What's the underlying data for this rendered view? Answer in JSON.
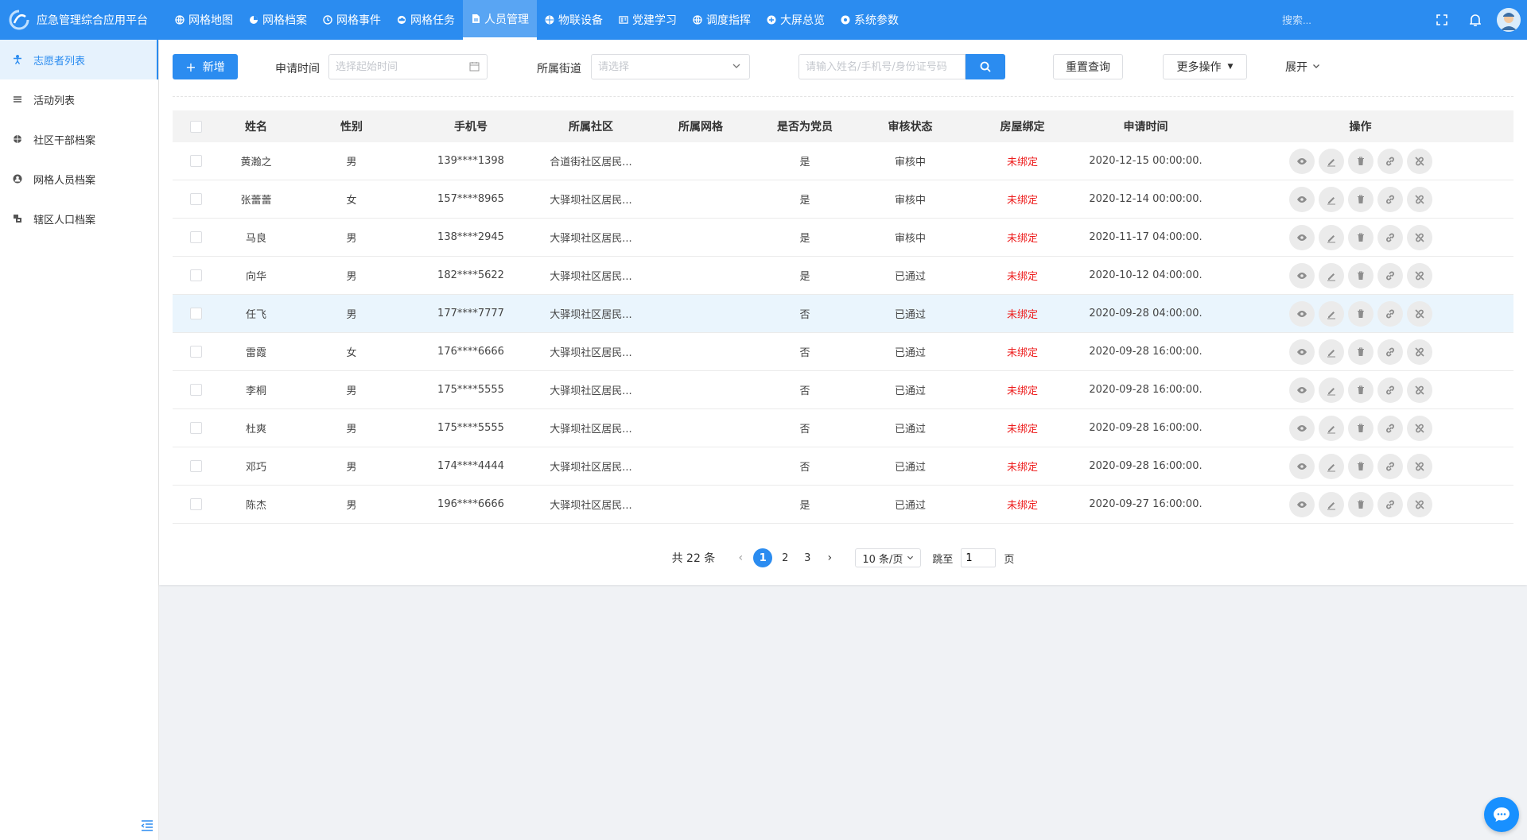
{
  "app": {
    "title": "应急管理综合应用平台"
  },
  "nav": [
    {
      "label": "网格地图",
      "icon": "globe-icon"
    },
    {
      "label": "网格档案",
      "icon": "pie-icon"
    },
    {
      "label": "网格事件",
      "icon": "clock-icon"
    },
    {
      "label": "网格任务",
      "icon": "cloud-icon"
    },
    {
      "label": "人员管理",
      "icon": "file-icon",
      "active": true
    },
    {
      "label": "物联设备",
      "icon": "bug-icon"
    },
    {
      "label": "党建学习",
      "icon": "book-icon"
    },
    {
      "label": "调度指挥",
      "icon": "globe-icon"
    },
    {
      "label": "大屏总览",
      "icon": "plus-circle-icon"
    },
    {
      "label": "系统参数",
      "icon": "settings-icon"
    }
  ],
  "top": {
    "search_placeholder": "搜索..."
  },
  "sidebar": [
    {
      "label": "志愿者列表",
      "icon": "volunteer-icon",
      "active": true
    },
    {
      "label": "活动列表",
      "icon": "list-icon"
    },
    {
      "label": "社区干部档案",
      "icon": "bug-icon"
    },
    {
      "label": "网格人员档案",
      "icon": "user-icon"
    },
    {
      "label": "辖区人口档案",
      "icon": "population-icon"
    }
  ],
  "toolbar": {
    "add_label": "新增",
    "date_label": "申请时间",
    "date_placeholder": "选择起始时间",
    "street_label": "所属街道",
    "street_placeholder": "请选择",
    "keyword_placeholder": "请输入姓名/手机号/身份证号码",
    "reset_label": "重置查询",
    "more_label": "更多操作",
    "expand_label": "展开"
  },
  "table": {
    "headers": [
      "姓名",
      "性别",
      "手机号",
      "所属社区",
      "所属网格",
      "是否为党员",
      "审核状态",
      "房屋绑定",
      "申请时间",
      "操作"
    ],
    "rows": [
      {
        "name": "黄瀚之",
        "gender": "男",
        "phone": "139****1398",
        "community": "合道街社区居民...",
        "grid": "",
        "party": "是",
        "audit": "审核中",
        "house": "未绑定",
        "time": "2020-12-15 00:00:00."
      },
      {
        "name": "张蕾蕾",
        "gender": "女",
        "phone": "157****8965",
        "community": "大驿坝社区居民...",
        "grid": "",
        "party": "是",
        "audit": "审核中",
        "house": "未绑定",
        "time": "2020-12-14 00:00:00."
      },
      {
        "name": "马良",
        "gender": "男",
        "phone": "138****2945",
        "community": "大驿坝社区居民...",
        "grid": "",
        "party": "是",
        "audit": "审核中",
        "house": "未绑定",
        "time": "2020-11-17 04:00:00."
      },
      {
        "name": "向华",
        "gender": "男",
        "phone": "182****5622",
        "community": "大驿坝社区居民...",
        "grid": "",
        "party": "是",
        "audit": "已通过",
        "house": "未绑定",
        "time": "2020-10-12 04:00:00."
      },
      {
        "name": "任飞",
        "gender": "男",
        "phone": "177****7777",
        "community": "大驿坝社区居民...",
        "grid": "",
        "party": "否",
        "audit": "已通过",
        "house": "未绑定",
        "time": "2020-09-28 04:00:00.",
        "highlight": true
      },
      {
        "name": "雷霞",
        "gender": "女",
        "phone": "176****6666",
        "community": "大驿坝社区居民...",
        "grid": "",
        "party": "否",
        "audit": "已通过",
        "house": "未绑定",
        "time": "2020-09-28 16:00:00."
      },
      {
        "name": "李桐",
        "gender": "男",
        "phone": "175****5555",
        "community": "大驿坝社区居民...",
        "grid": "",
        "party": "否",
        "audit": "已通过",
        "house": "未绑定",
        "time": "2020-09-28 16:00:00."
      },
      {
        "name": "杜爽",
        "gender": "男",
        "phone": "175****5555",
        "community": "大驿坝社区居民...",
        "grid": "",
        "party": "否",
        "audit": "已通过",
        "house": "未绑定",
        "time": "2020-09-28 16:00:00."
      },
      {
        "name": "邓巧",
        "gender": "男",
        "phone": "174****4444",
        "community": "大驿坝社区居民...",
        "grid": "",
        "party": "否",
        "audit": "已通过",
        "house": "未绑定",
        "time": "2020-09-28 16:00:00."
      },
      {
        "name": "陈杰",
        "gender": "男",
        "phone": "196****6666",
        "community": "大驿坝社区居民...",
        "grid": "",
        "party": "是",
        "audit": "已通过",
        "house": "未绑定",
        "time": "2020-09-27 16:00:00."
      }
    ],
    "row_actions": [
      "view-icon",
      "edit-icon",
      "delete-icon",
      "link-icon",
      "unlink-icon"
    ]
  },
  "pagination": {
    "total_text": "共 22 条",
    "pages": [
      "1",
      "2",
      "3"
    ],
    "current": "1",
    "page_size": "10 条/页",
    "goto_label": "跳至",
    "goto_value": "1",
    "page_suffix": "页"
  },
  "colors": {
    "primary": "#2b8cf0",
    "danger": "#ed1d1d"
  }
}
